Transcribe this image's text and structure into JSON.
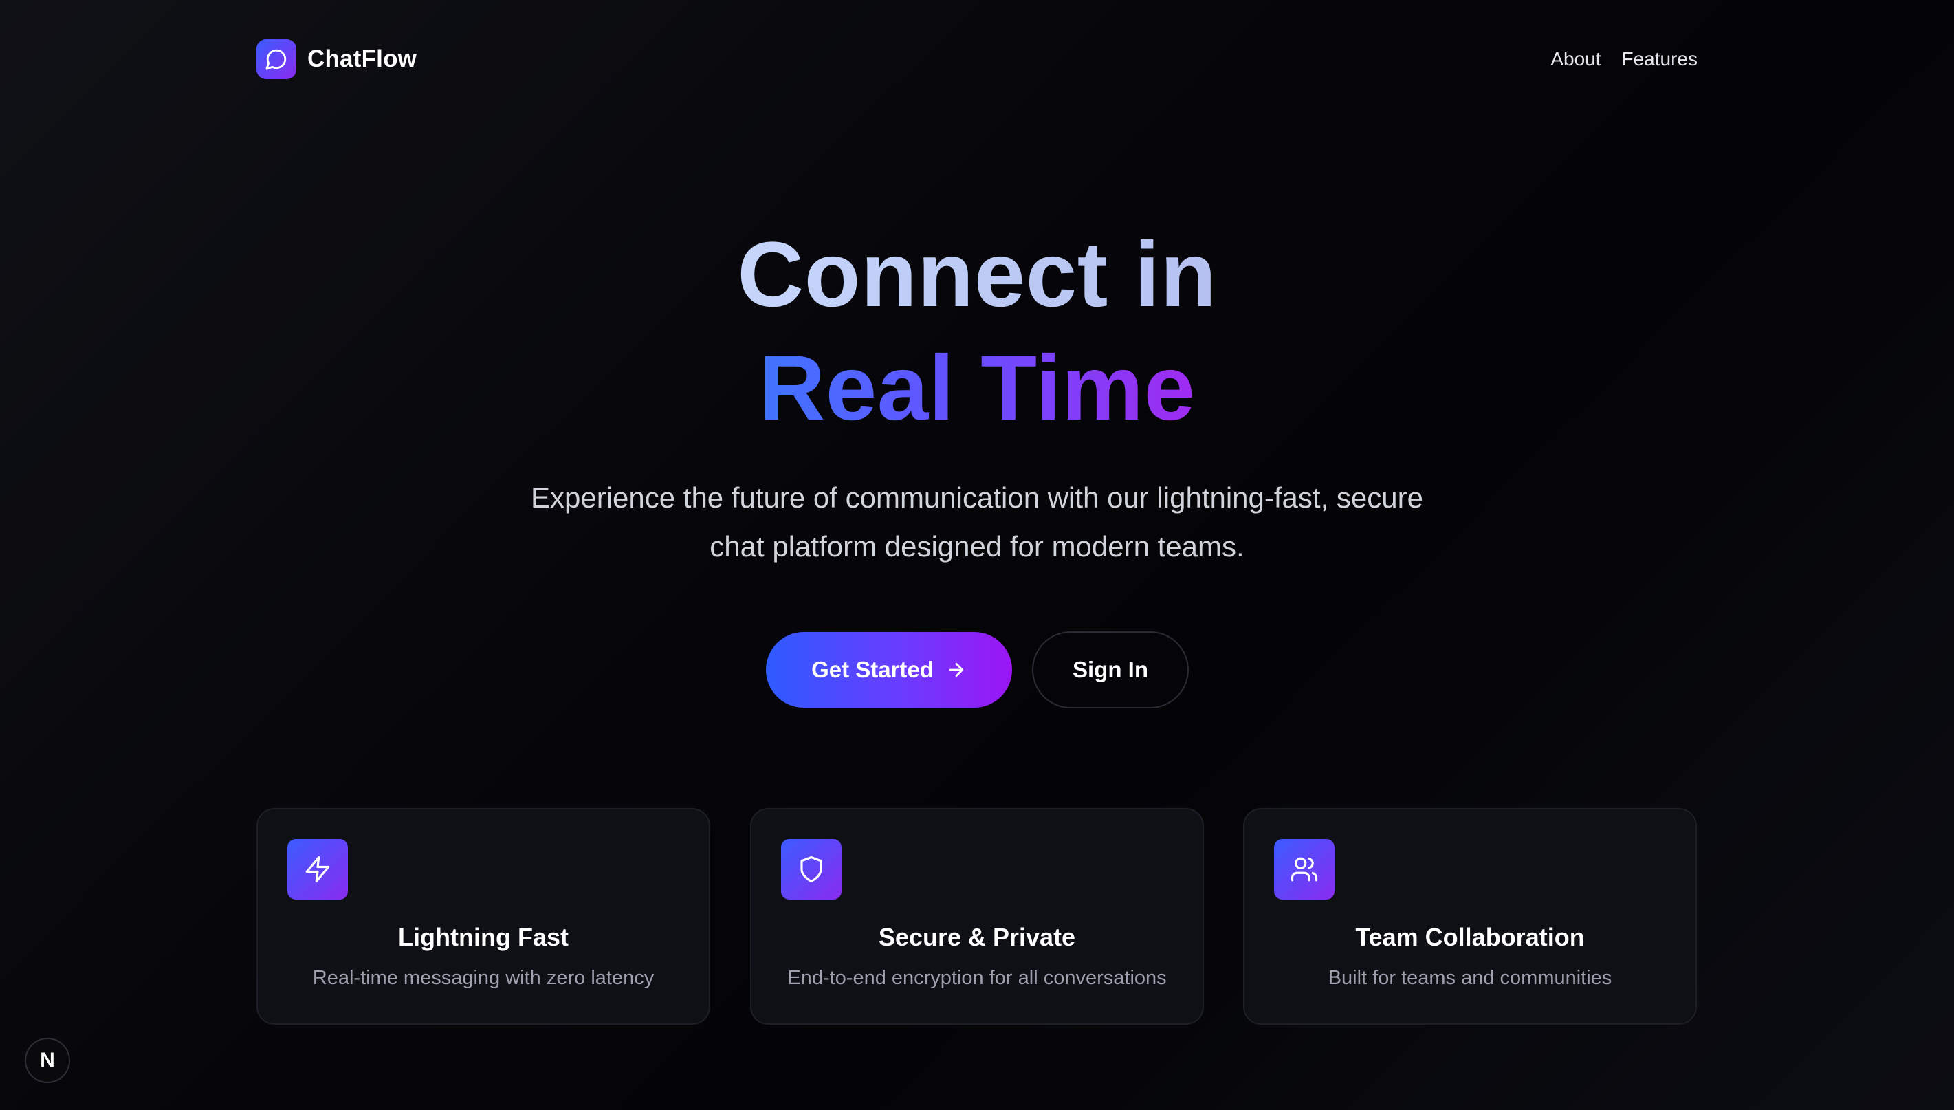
{
  "header": {
    "brand": "ChatFlow",
    "nav": [
      "About",
      "Features"
    ]
  },
  "hero": {
    "headline_line1": "Connect in",
    "headline_line2": "Real Time",
    "subtitle_line1": "Experience the future of communication with our lightning-fast, secure",
    "subtitle_line2": "chat platform designed for modern teams.",
    "primary_button": "Get Started",
    "secondary_button": "Sign In"
  },
  "features": [
    {
      "icon": "lightning-icon",
      "title": "Lightning Fast",
      "description": "Real-time messaging with zero latency"
    },
    {
      "icon": "shield-icon",
      "title": "Secure & Private",
      "description": "End-to-end encryption for all conversations"
    },
    {
      "icon": "users-icon",
      "title": "Team Collaboration",
      "description": "Built for teams and communities"
    }
  ],
  "dev_badge": "N",
  "colors": {
    "accent_start": "#2e5bff",
    "accent_end": "#9b16f2",
    "background": "#050508",
    "card_background": "#0e1016"
  }
}
